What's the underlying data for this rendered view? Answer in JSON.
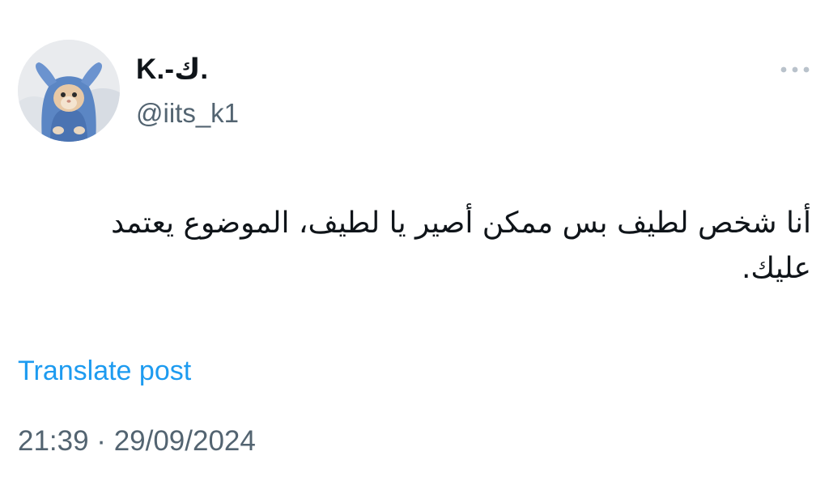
{
  "author": {
    "display_name": "K.-ك.",
    "handle": "@iits_k1",
    "avatar_icon": "cat-in-blue-hoodie-avatar"
  },
  "more_icon": "more-horizontal-icon",
  "tweet": {
    "text": "أنا شخص لطيف بس ممكن أصير يا لطيف، الموضوع يعتمد عليك."
  },
  "translate_label": "Translate post",
  "timestamp": "21:39 · 29/09/2024",
  "colors": {
    "text": "#0f1419",
    "secondary": "#536471",
    "link": "#1d9bf0",
    "background": "#ffffff"
  }
}
